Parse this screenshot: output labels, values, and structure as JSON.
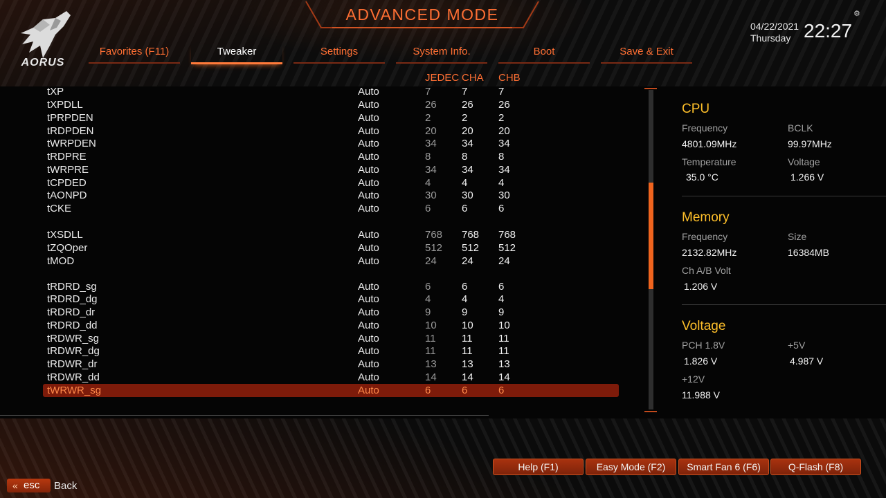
{
  "header": {
    "title": "ADVANCED MODE",
    "brand": "AORUS",
    "date": "04/22/2021",
    "day": "Thursday",
    "time": "22:27"
  },
  "tabs": [
    {
      "label": "Favorites (F11)",
      "active": false
    },
    {
      "label": "Tweaker",
      "active": true
    },
    {
      "label": "Settings",
      "active": false
    },
    {
      "label": "System Info.",
      "active": false
    },
    {
      "label": "Boot",
      "active": false
    },
    {
      "label": "Save & Exit",
      "active": false
    }
  ],
  "columns": {
    "jedec": "JEDEC",
    "cha": "CHA",
    "chb": "CHB"
  },
  "rows": [
    {
      "name": "tXP",
      "value": "Auto",
      "jedec": "7",
      "cha": "7",
      "chb": "7"
    },
    {
      "name": "tXPDLL",
      "value": "Auto",
      "jedec": "26",
      "cha": "26",
      "chb": "26"
    },
    {
      "name": "tPRPDEN",
      "value": "Auto",
      "jedec": "2",
      "cha": "2",
      "chb": "2"
    },
    {
      "name": "tRDPDEN",
      "value": "Auto",
      "jedec": "20",
      "cha": "20",
      "chb": "20"
    },
    {
      "name": "tWRPDEN",
      "value": "Auto",
      "jedec": "34",
      "cha": "34",
      "chb": "34"
    },
    {
      "name": "tRDPRE",
      "value": "Auto",
      "jedec": "8",
      "cha": "8",
      "chb": "8"
    },
    {
      "name": "tWRPRE",
      "value": "Auto",
      "jedec": "34",
      "cha": "34",
      "chb": "34"
    },
    {
      "name": "tCPDED",
      "value": "Auto",
      "jedec": "4",
      "cha": "4",
      "chb": "4"
    },
    {
      "name": "tAONPD",
      "value": "Auto",
      "jedec": "30",
      "cha": "30",
      "chb": "30"
    },
    {
      "name": "tCKE",
      "value": "Auto",
      "jedec": "6",
      "cha": "6",
      "chb": "6"
    },
    {
      "name": "tXSDLL",
      "value": "Auto",
      "jedec": "768",
      "cha": "768",
      "chb": "768"
    },
    {
      "name": "tZQOper",
      "value": "Auto",
      "jedec": "512",
      "cha": "512",
      "chb": "512"
    },
    {
      "name": "tMOD",
      "value": "Auto",
      "jedec": "24",
      "cha": "24",
      "chb": "24"
    },
    {
      "name": "tRDRD_sg",
      "value": "Auto",
      "jedec": "6",
      "cha": "6",
      "chb": "6"
    },
    {
      "name": "tRDRD_dg",
      "value": "Auto",
      "jedec": "4",
      "cha": "4",
      "chb": "4"
    },
    {
      "name": "tRDRD_dr",
      "value": "Auto",
      "jedec": "9",
      "cha": "9",
      "chb": "9"
    },
    {
      "name": "tRDRD_dd",
      "value": "Auto",
      "jedec": "10",
      "cha": "10",
      "chb": "10"
    },
    {
      "name": "tRDWR_sg",
      "value": "Auto",
      "jedec": "11",
      "cha": "11",
      "chb": "11"
    },
    {
      "name": "tRDWR_dg",
      "value": "Auto",
      "jedec": "11",
      "cha": "11",
      "chb": "11"
    },
    {
      "name": "tRDWR_dr",
      "value": "Auto",
      "jedec": "13",
      "cha": "13",
      "chb": "13"
    },
    {
      "name": "tRDWR_dd",
      "value": "Auto",
      "jedec": "14",
      "cha": "14",
      "chb": "14"
    },
    {
      "name": "tWRWR_sg",
      "value": "Auto",
      "jedec": "6",
      "cha": "6",
      "chb": "6",
      "selected": true
    }
  ],
  "panel": {
    "cpu": {
      "title": "CPU",
      "frequency_label": "Frequency",
      "frequency": "4801.09MHz",
      "bclk_label": "BCLK",
      "bclk": "99.97MHz",
      "temperature_label": "Temperature",
      "temperature": "35.0 °C",
      "voltage_label": "Voltage",
      "voltage": "1.266 V"
    },
    "memory": {
      "title": "Memory",
      "frequency_label": "Frequency",
      "frequency": "2132.82MHz",
      "size_label": "Size",
      "size": "16384MB",
      "volt_label": "Ch A/B Volt",
      "volt": "1.206 V"
    },
    "voltage": {
      "title": "Voltage",
      "pch_label": "PCH 1.8V",
      "pch": "1.826 V",
      "v5_label": "+5V",
      "v5": "4.987 V",
      "v12_label": "+12V",
      "v12": "11.988 V"
    }
  },
  "footer": {
    "buttons": [
      "Help (F1)",
      "Easy Mode (F2)",
      "Smart Fan 6 (F6)",
      "Q-Flash (F8)"
    ],
    "esc_label": "esc",
    "back_label": "Back"
  },
  "colors": {
    "accent": "#ff6f33",
    "panel_title": "#ffc02a",
    "selection": "#7d1b0a"
  }
}
